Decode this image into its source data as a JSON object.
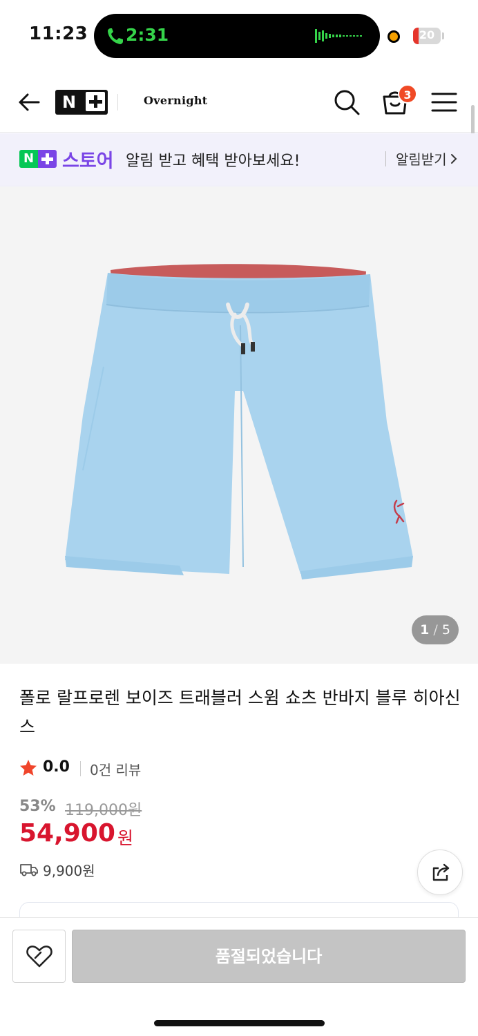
{
  "status_bar": {
    "time": "11:23",
    "call_time": "2:31",
    "battery": "20",
    "battery_level": 0.2
  },
  "header": {
    "brand": "Overnight",
    "cart_count": "3"
  },
  "banner": {
    "store": "스토어",
    "message": "알림 받고 혜택 받아보세요!",
    "cta": "알림받기"
  },
  "image": {
    "current": "1",
    "separator": "/",
    "total": "5"
  },
  "product": {
    "title": "폴로 랄프로렌 보이즈 트래블러 스윔 쇼츠 반바지 블루 히아신스",
    "rating": "0.0",
    "review_count": "0건 리뷰",
    "discount": "53%",
    "original_price": "119,000원",
    "price": "54,900",
    "price_unit": "원",
    "shipping_fee": "9,900원"
  },
  "bottom": {
    "soldout_label": "품절되었습니다"
  },
  "colors": {
    "accent_purple": "#7a45e6",
    "naver_green": "#06c755",
    "price_red": "#d8152e",
    "badge_orange": "#f04a26"
  }
}
